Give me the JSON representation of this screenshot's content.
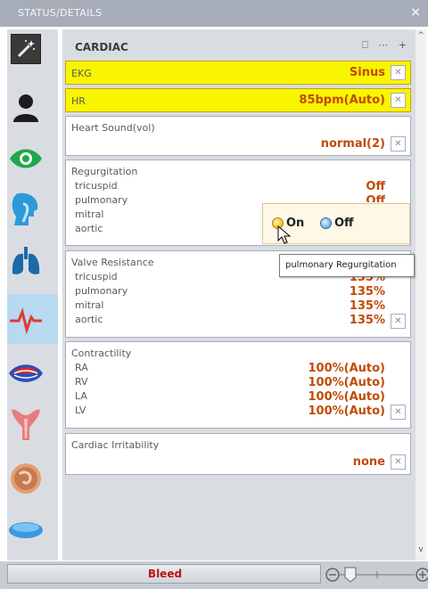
{
  "window": {
    "title": "STATUS/DETAILS",
    "close_label": "×"
  },
  "section": {
    "title": "CARDIAC",
    "header_icons": [
      "⎕",
      "⋯",
      "+"
    ]
  },
  "ekg": {
    "label": "EKG",
    "value": "Sinus"
  },
  "hr": {
    "label": "HR",
    "value": "85bpm(Auto)"
  },
  "heart_sound": {
    "label": "Heart Sound(vol)",
    "value": "normal(2)"
  },
  "regurgitation": {
    "label": "Regurgitation",
    "items": [
      {
        "name": "tricuspid",
        "value": "Off"
      },
      {
        "name": "pulmonary",
        "value": "Off"
      },
      {
        "name": "mitral",
        "value": ""
      },
      {
        "name": "aortic",
        "value": ""
      }
    ]
  },
  "popup": {
    "on_label": "On",
    "off_label": "Off",
    "selected": "On"
  },
  "tooltip": "pulmonary Regurgitation",
  "valve_resistance": {
    "label": "Valve Resistance",
    "items": [
      {
        "name": "tricuspid",
        "value": "135%"
      },
      {
        "name": "pulmonary",
        "value": "135%"
      },
      {
        "name": "mitral",
        "value": "135%"
      },
      {
        "name": "aortic",
        "value": "135%"
      }
    ]
  },
  "contractility": {
    "label": "Contractility",
    "items": [
      {
        "name": "RA",
        "value": "100%(Auto)"
      },
      {
        "name": "RV",
        "value": "100%(Auto)"
      },
      {
        "name": "LA",
        "value": "100%(Auto)"
      },
      {
        "name": "LV",
        "value": "100%(Auto)"
      }
    ]
  },
  "irritability": {
    "label": "Cardiac Irritability",
    "value": "none"
  },
  "footer": {
    "bleed_label": "Bleed"
  },
  "colors": {
    "value_orange": "#c24a06",
    "highlight_yellow": "#f9f500",
    "selected_tab": "#b8d9ef"
  }
}
